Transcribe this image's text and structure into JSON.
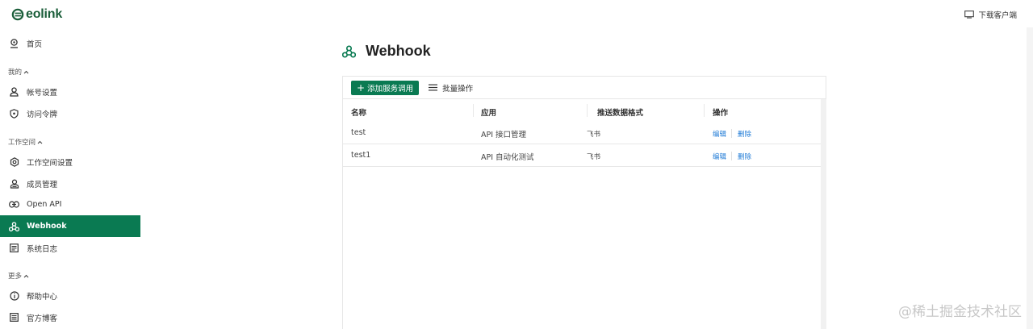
{
  "brand": {
    "name": "eolink",
    "color": "#1b5e3a"
  },
  "topbar": {
    "download_label": "下载客户端"
  },
  "sidebar": {
    "home": "首页",
    "sections": {
      "mine": "我的",
      "workspace": "工作空间",
      "more": "更多"
    },
    "items": {
      "account": "帐号设置",
      "token": "访问令牌",
      "ws_settings": "工作空间设置",
      "members": "成员管理",
      "openapi": "Open API",
      "webhook": "Webhook",
      "logs": "系统日志",
      "help": "帮助中心",
      "blog": "官方博客"
    },
    "active_color": "#0a7a52"
  },
  "main": {
    "title": "Webhook",
    "toolbar": {
      "add_label": "添加服务调用",
      "batch_label": "批量操作"
    },
    "table": {
      "columns": [
        "名称",
        "应用",
        "推送数据格式",
        "操作"
      ],
      "rows": [
        {
          "name": "test",
          "app": "API 接口管理",
          "format": "飞书",
          "edit": "编辑",
          "delete": "删除"
        },
        {
          "name": "test1",
          "app": "API 自动化测试",
          "format": "飞书",
          "edit": "编辑",
          "delete": "删除"
        }
      ]
    }
  },
  "watermark": "@稀土掘金技术社区"
}
